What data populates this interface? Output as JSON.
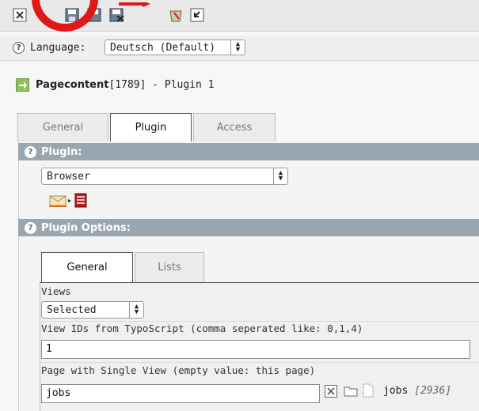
{
  "language": {
    "label": "Language:",
    "selected": "Deutsch (Default)"
  },
  "page_header": {
    "title_bold": "Pagecontent",
    "title_rest": " [1789] - Plugin 1"
  },
  "main_tabs": [
    {
      "label": "General",
      "active": false
    },
    {
      "label": "Plugin",
      "active": true
    },
    {
      "label": "Access",
      "active": false
    }
  ],
  "plugin_section": {
    "title": "Plugin:",
    "select_value": "Browser"
  },
  "options_section": {
    "title": "Plugin Options:",
    "tabs": [
      {
        "label": "General",
        "active": true
      },
      {
        "label": "Lists",
        "active": false
      }
    ]
  },
  "fields": {
    "views_label": "Views",
    "views_value": "Selected",
    "view_ids_label": "View IDs from TypoScript (comma seperated like: 0,1,4)",
    "view_ids_value": "1",
    "single_view_label": "Page with Single View (empty value: this page)",
    "single_view_value": "jobs",
    "single_view_ref_name": "jobs",
    "single_view_ref_id": "[2936]"
  },
  "colors": {
    "annotation_red": "#e01818",
    "section_bar": "#9aa6b0"
  }
}
